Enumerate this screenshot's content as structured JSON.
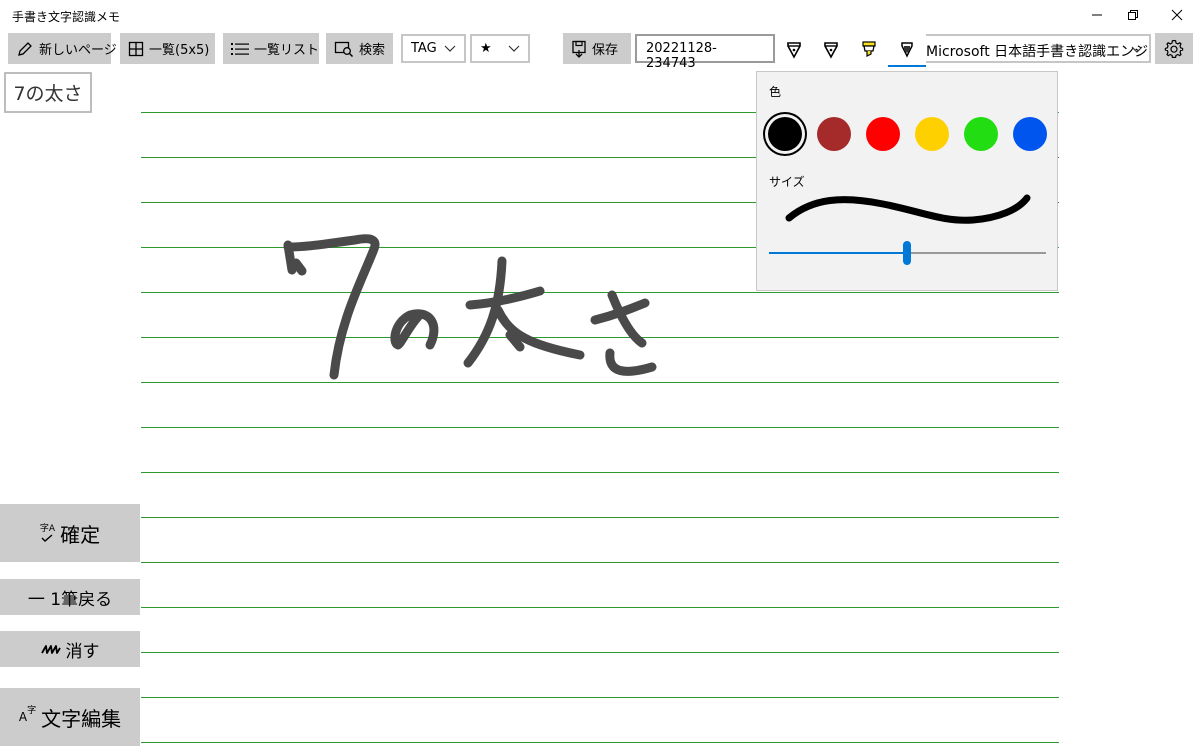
{
  "window": {
    "title": "手書き文字認識メモ"
  },
  "toolbar": {
    "new_page": "新しいページ",
    "grid_view": "一覧(5x5)",
    "list_view": "一覧リスト",
    "search": "検索",
    "tag": "TAG",
    "star": "★",
    "save": "保存",
    "filename": "20221128-234743",
    "engine": "Microsoft 日本語手書き認識エンジン"
  },
  "recognized_text": "7の太さ",
  "side_buttons": {
    "confirm": "確定",
    "confirm_badge": "字A",
    "undo": "一 1筆戻る",
    "erase": "消す",
    "edit": "文字編集",
    "edit_badge": "字"
  },
  "pen_popup": {
    "color_label": "色",
    "size_label": "サイズ",
    "colors": [
      {
        "name": "black",
        "hex": "#000000",
        "selected": true
      },
      {
        "name": "dark-red",
        "hex": "#a52a2a",
        "selected": false
      },
      {
        "name": "red",
        "hex": "#ff0000",
        "selected": false
      },
      {
        "name": "yellow",
        "hex": "#ffd000",
        "selected": false
      },
      {
        "name": "green",
        "hex": "#22dd11",
        "selected": false
      },
      {
        "name": "blue",
        "hex": "#0055ee",
        "selected": false
      }
    ],
    "size_slider_value": 0.5
  },
  "colors": {
    "accent": "#0078d7",
    "rule_line": "#2e9a2e",
    "button_bg": "#cccccc",
    "ink": "#4a4a4a"
  }
}
